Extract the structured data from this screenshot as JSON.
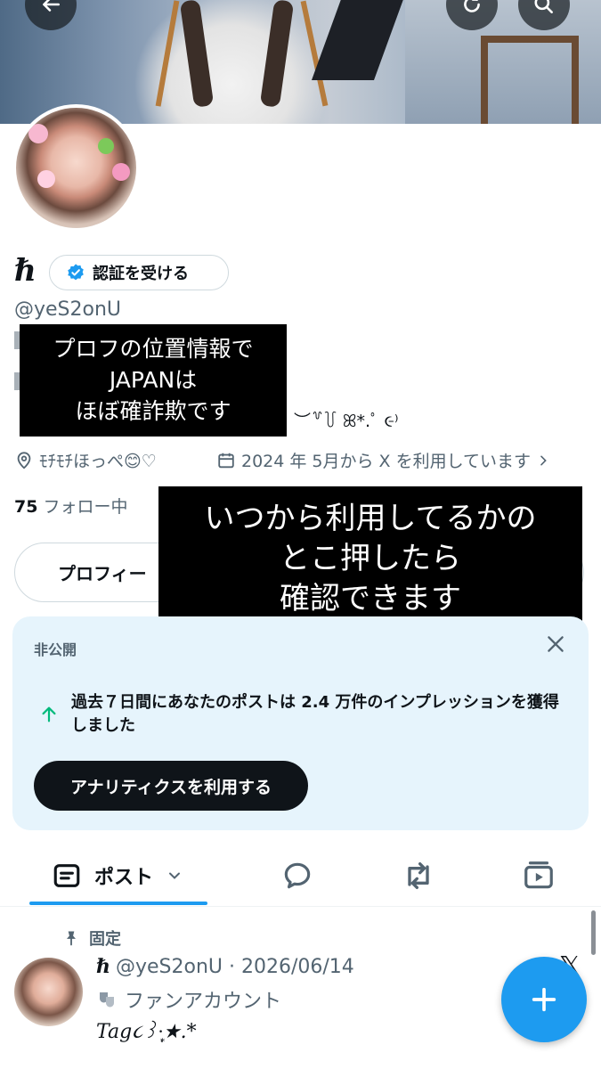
{
  "profile": {
    "name_glyph": "ℏ",
    "verify_label": "認証を受ける",
    "handle": "@yeS2onU",
    "bio_tail": "︶꒷꒦ ꕤ*.ﾟ ૯⁾",
    "location": "ﾓﾁﾓﾁほっぺ😊♡",
    "joined": "2024 年 5月から X を利用しています",
    "following_count": "75",
    "following_label": "フォロー中",
    "edit_label": "プロフィー"
  },
  "annotations": {
    "left": [
      "プロフの位置情報で",
      "JAPANは",
      "ほぼ確詐欺です"
    ],
    "right": [
      "いつから利用してるかの",
      "とこ押したら",
      "確認できます"
    ]
  },
  "analytics_card": {
    "private_label": "非公開",
    "message": "過去７日間にあなたのポストは 2.4 万件のインプレッションを獲得しました",
    "cta": "アナリティクスを利用する"
  },
  "tabs": {
    "posts_label": "ポスト"
  },
  "pinned_post": {
    "pinned_label": "固定",
    "name_glyph": "ℏ",
    "handle_date": "@yeS2onU · 2026/06/14",
    "label": "ファンアカウント",
    "body": "Tag૮꒱·̩͙★.*"
  },
  "colors": {
    "accent": "#1d9bf0",
    "text": "#0f1419",
    "muted": "#536471",
    "card_bg": "#e6f4fc",
    "analytics_up": "#00ba7c"
  }
}
